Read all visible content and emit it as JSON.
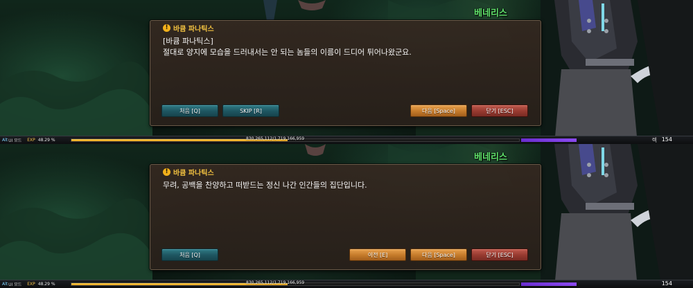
{
  "panels": [
    {
      "region_name": "베네리스",
      "speaker": "바큠 파나틱스",
      "lines": [
        "[바큠 파나틱스]",
        "절대로 양지에 모습을 드러내서는 안 되는 놈들의 이름이 드디어 튀어나왔군요."
      ],
      "buttons": {
        "first": "처음 [Q]",
        "skip": "SKIP [R]",
        "next": "다음 [Space]",
        "close": "닫기 [ESC]"
      },
      "status": {
        "ui_tag": "Alt",
        "ui_tag2": "",
        "ui_label": "UI 모드",
        "exp_label": "EXP",
        "exp_percent": "48.29 %",
        "exp_detail": "830,265,112/1,719,166,959",
        "exp_fraction": 0.4829,
        "level_label": "렉",
        "level": "154"
      }
    },
    {
      "region_name": "베네리스",
      "speaker": "바큠 파나틱스",
      "lines": [
        "무려, 공백을 찬양하고 떠받드는 정신 나간 인간들의 집단입니다."
      ],
      "buttons": {
        "first": "처음 [Q]",
        "prev": "이전 [E]",
        "next": "다음 [Space]",
        "close": "닫기 [ESC]"
      },
      "status": {
        "ui_tag": "Alt",
        "ui_tag2": "",
        "ui_label": "UI 모드",
        "exp_label": "EXP",
        "exp_percent": "48.29 %",
        "exp_detail": "830,265,112/1,719,166,959",
        "exp_fraction": 0.4829,
        "level_label": "",
        "level": "154"
      }
    }
  ],
  "colors": {
    "region_name": "#5fe06a",
    "speaker": "#f0c040",
    "exp_fill": "#f0ad22",
    "mp_bar": "#7a3ae0",
    "button_teal": "#1e5560",
    "button_orange": "#c47a2a",
    "button_red": "#96392f"
  },
  "icons": {
    "speaker_icon": "exclamation-warning-icon"
  }
}
